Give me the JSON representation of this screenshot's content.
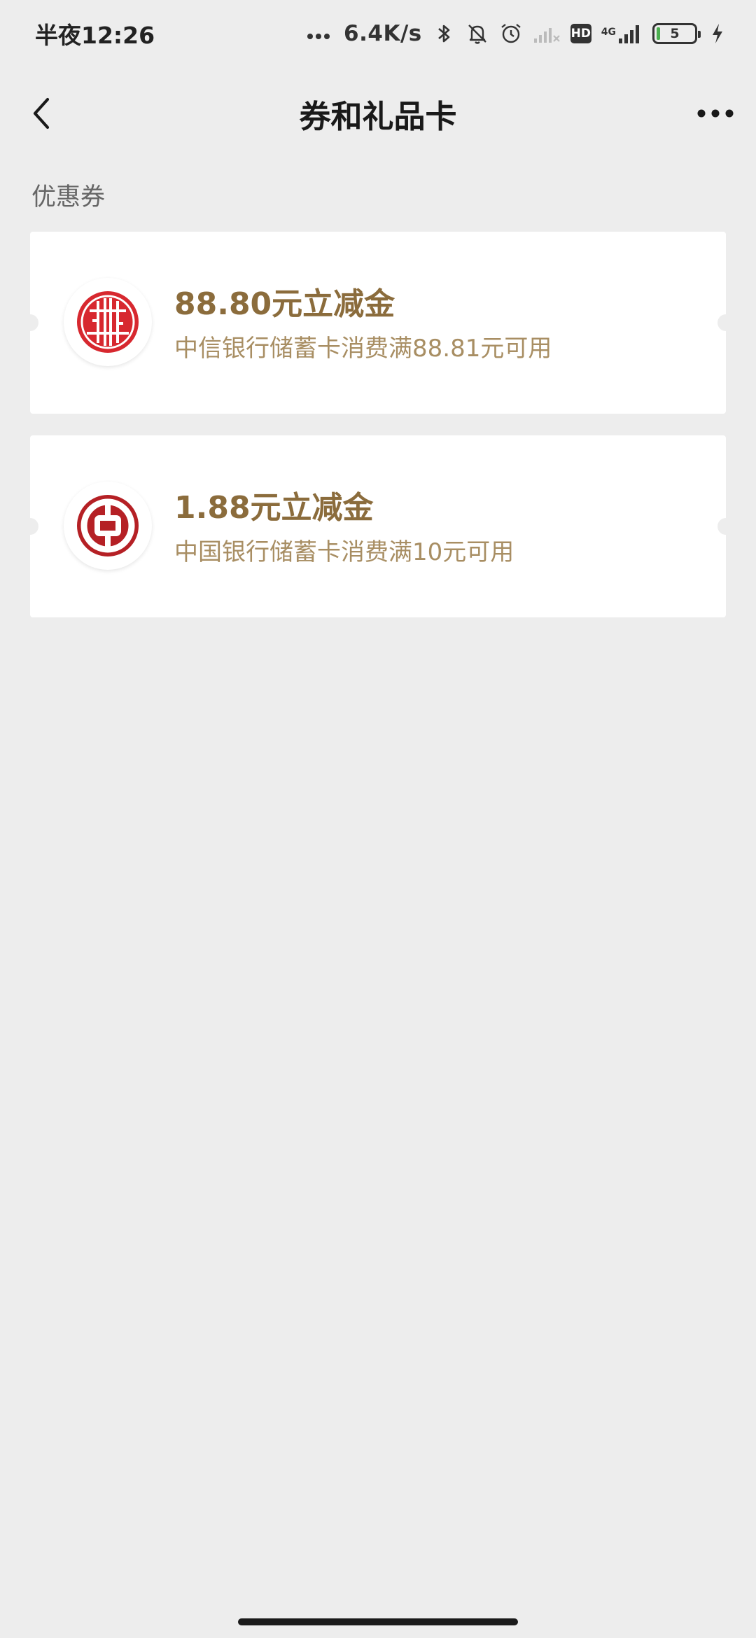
{
  "status_bar": {
    "time": "半夜12:26",
    "network_speed": "6.4K/s",
    "network_type": "4G",
    "hd_label": "HD",
    "battery_level": "5",
    "icons": [
      "more-dots-icon",
      "bluetooth-icon",
      "mute-bell-icon",
      "alarm-icon",
      "signal-x-icon",
      "hd-icon",
      "signal-icon",
      "battery-icon",
      "charging-icon"
    ]
  },
  "nav": {
    "title": "券和礼品卡",
    "back_icon": "chevron-left-icon",
    "more_icon": "more-horizontal-icon"
  },
  "section": {
    "title": "优惠券"
  },
  "coupons": [
    {
      "bank_logo": "citic-bank-logo",
      "amount": "88.80元立减金",
      "description": "中信银行储蓄卡消费满88.81元可用"
    },
    {
      "bank_logo": "bank-of-china-logo",
      "amount": "1.88元立减金",
      "description": "中国银行储蓄卡消费满10元可用"
    }
  ],
  "colors": {
    "background": "#ededed",
    "card": "#ffffff",
    "amount_text": "#8b6c3c",
    "description_text": "#a88e63",
    "citic_red": "#d7282f",
    "boc_red": "#b52025"
  }
}
